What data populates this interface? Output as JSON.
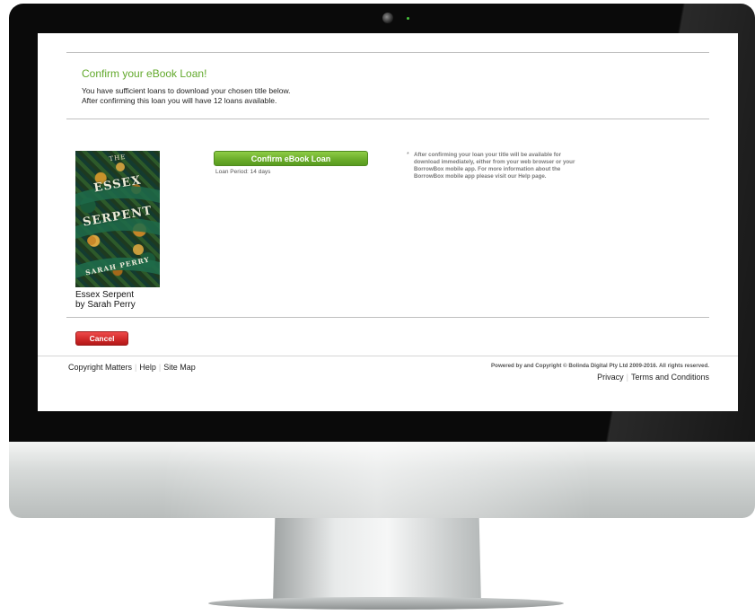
{
  "colors": {
    "heading_green": "#62a92c",
    "confirm_button": "#6cae2b",
    "cancel_button": "#d12a2a",
    "monitor_bezel": "#0a0a0a",
    "camera_led": "#47c13c"
  },
  "confirm": {
    "heading": "Confirm your eBook Loan!",
    "message_line1": "You have sufficient loans to download your chosen title below.",
    "message_line2": "After confirming this loan you will have 12 loans available."
  },
  "book": {
    "cover_the": "THE",
    "cover_title_line1": "ESSEX",
    "cover_title_line2": "SERPENT",
    "cover_author": "SARAH PERRY",
    "title": "Essex Serpent",
    "author": "by Sarah Perry"
  },
  "actions": {
    "confirm_label": "Confirm eBook Loan",
    "loan_period": "Loan Period: 14 days",
    "cancel_label": "Cancel"
  },
  "note": {
    "star": "*",
    "line1": "After confirming your loan your title will be available for",
    "line2": "download immediately, either from your web browser or your",
    "line3": "BorrowBox mobile app. For more information about the",
    "line4_prefix": "BorrowBox mobile app please visit our ",
    "help_link": "Help",
    "line4_suffix": " page."
  },
  "footer": {
    "links": [
      "Copyright Matters",
      "Help",
      "Site Map"
    ],
    "separator": "|",
    "powered": "Powered by and Copyright © Bolinda Digital Pty Ltd 2009-2016. All rights reserved.",
    "legal_links": [
      "Privacy",
      "Terms and Conditions"
    ]
  }
}
